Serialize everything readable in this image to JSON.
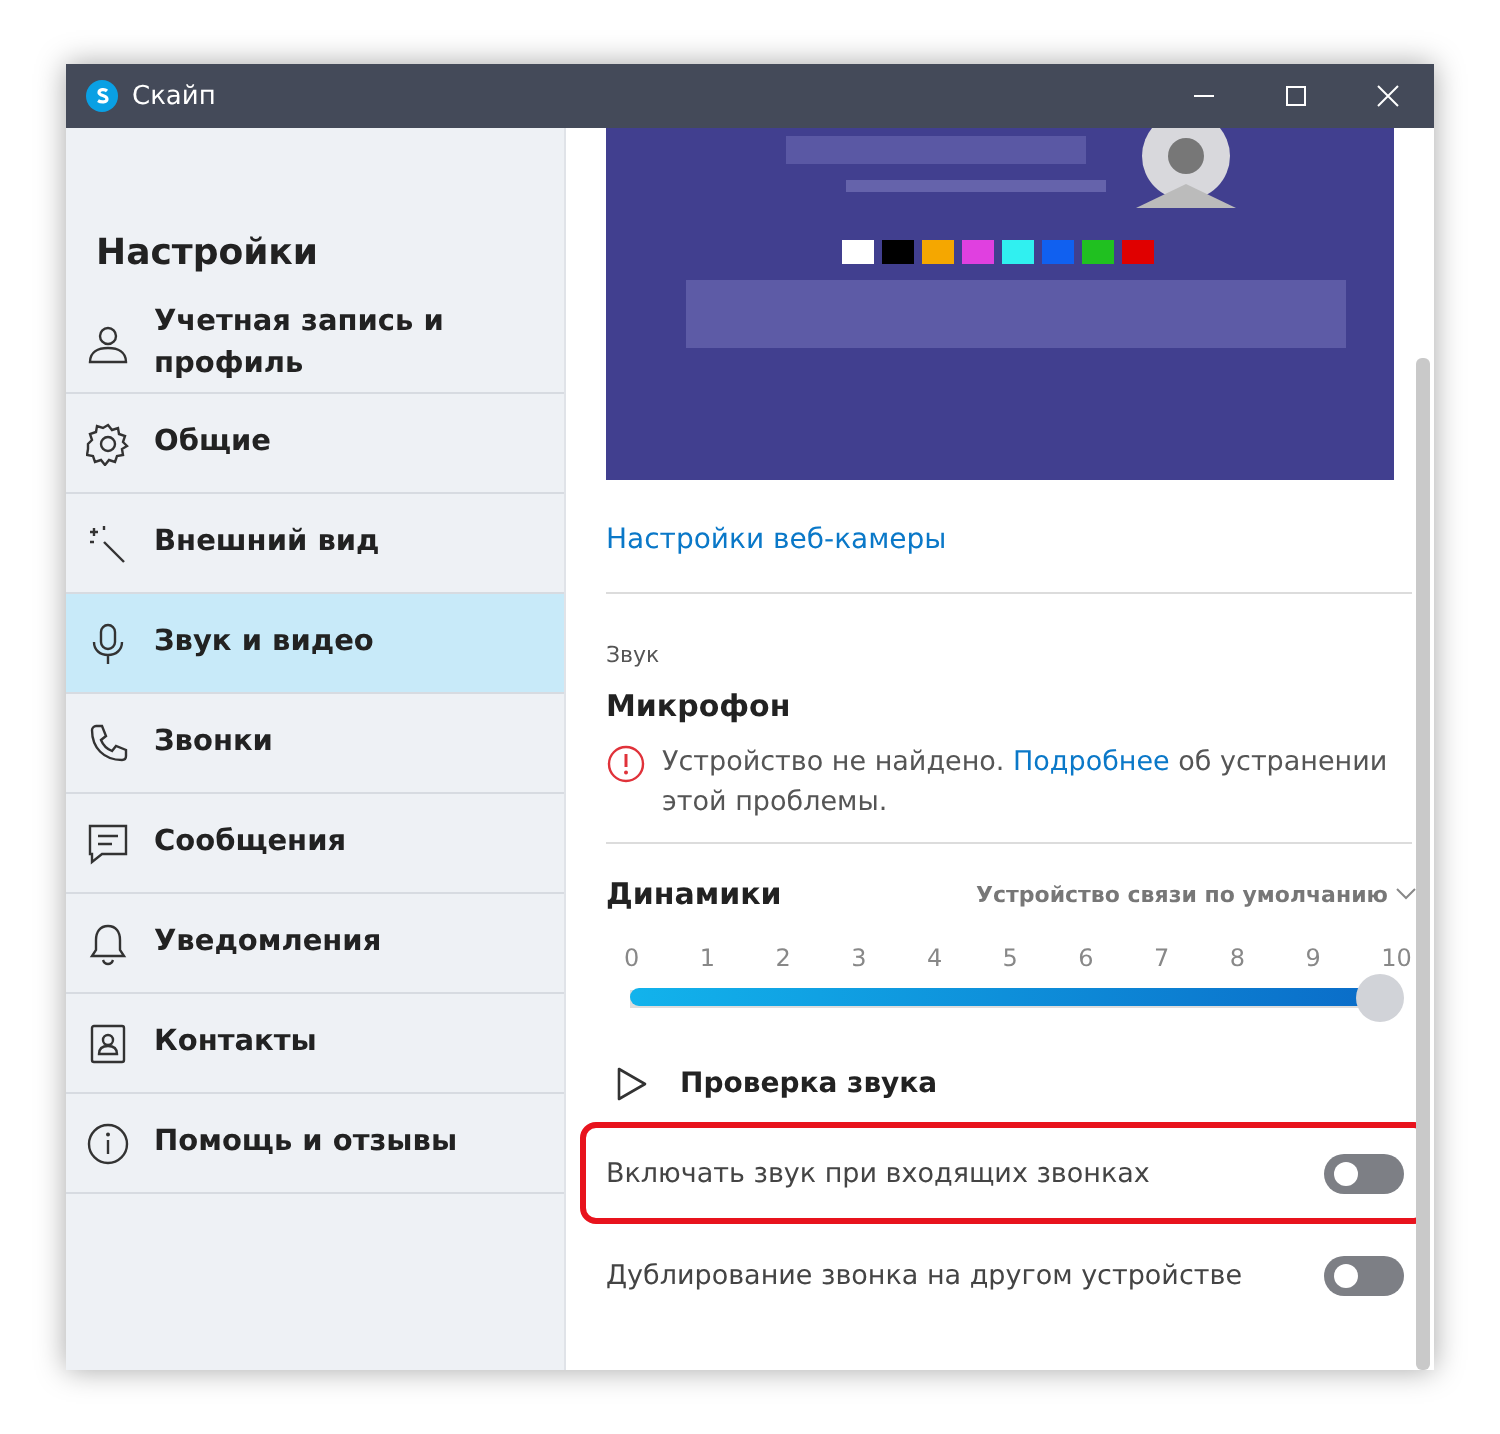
{
  "window": {
    "title": "Скайп"
  },
  "sidebar": {
    "heading": "Настройки",
    "items": [
      {
        "label": "Учетная запись и профиль",
        "selected": false
      },
      {
        "label": "Общие",
        "selected": false
      },
      {
        "label": "Внешний вид",
        "selected": false
      },
      {
        "label": "Звук и видео",
        "selected": true
      },
      {
        "label": "Звонки",
        "selected": false
      },
      {
        "label": "Сообщения",
        "selected": false
      },
      {
        "label": "Уведомления",
        "selected": false
      },
      {
        "label": "Контакты",
        "selected": false
      },
      {
        "label": "Помощь и отзывы",
        "selected": false
      }
    ]
  },
  "video": {
    "settings_link": "Настройки веб-камеры"
  },
  "audio": {
    "section": "Звук",
    "microphone": {
      "title": "Микрофон",
      "warning": {
        "text": "Устройство не найдено.",
        "link": "Подробнее",
        "rest": "об устранении этой проблемы."
      }
    },
    "speakers": {
      "title": "Динамики",
      "device": "Устройство связи по умолчанию",
      "ticks": [
        "0",
        "1",
        "2",
        "3",
        "4",
        "5",
        "6",
        "7",
        "8",
        "9",
        "10"
      ],
      "level": 1.0
    },
    "test": "Проверка звука"
  },
  "toggles": [
    {
      "label": "Включать звук при входящих звонках",
      "on": false,
      "highlighted": true
    },
    {
      "label": "Дублирование звонка на другом устройстве",
      "on": false,
      "highlighted": false
    }
  ]
}
